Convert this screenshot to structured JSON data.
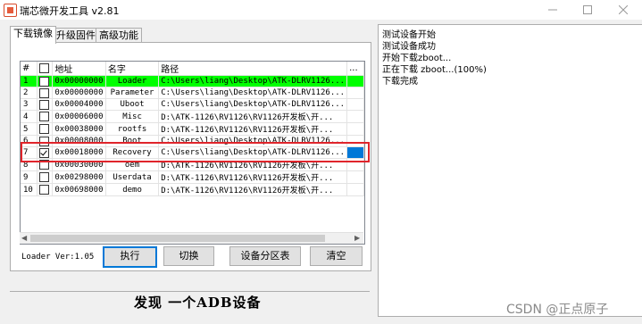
{
  "window": {
    "title": "瑞芯微开发工具 v2.81"
  },
  "tabs": [
    "下载镜像",
    "升级固件",
    "高级功能"
  ],
  "table": {
    "headers": [
      "#",
      "",
      "地址",
      "名字",
      "路径",
      "..."
    ],
    "rows": [
      {
        "num": "1",
        "checked": false,
        "addr": "0x00000000",
        "name": "Loader",
        "path": "C:\\Users\\liang\\Desktop\\ATK-DLRV1126..."
      },
      {
        "num": "2",
        "checked": false,
        "addr": "0x00000000",
        "name": "Parameter",
        "path": "C:\\Users\\liang\\Desktop\\ATK-DLRV1126..."
      },
      {
        "num": "3",
        "checked": false,
        "addr": "0x00004000",
        "name": "Uboot",
        "path": "C:\\Users\\liang\\Desktop\\ATK-DLRV1126..."
      },
      {
        "num": "4",
        "checked": false,
        "addr": "0x00006000",
        "name": "Misc",
        "path": "D:\\ATK-1126\\RV1126\\RV1126开发板\\开..."
      },
      {
        "num": "5",
        "checked": false,
        "addr": "0x00038000",
        "name": "rootfs",
        "path": "D:\\ATK-1126\\RV1126\\RV1126开发板\\开..."
      },
      {
        "num": "6",
        "checked": false,
        "addr": "0x00008000",
        "name": "Boot",
        "path": "C:\\Users\\liang\\Desktop\\ATK-DLRV1126..."
      },
      {
        "num": "7",
        "checked": true,
        "addr": "0x00018000",
        "name": "Recovery",
        "path": "C:\\Users\\liang\\Desktop\\ATK-DLRV1126..."
      },
      {
        "num": "8",
        "checked": false,
        "addr": "0x00030000",
        "name": "oem",
        "path": "D:\\ATK-1126\\RV1126\\RV1126开发板\\开..."
      },
      {
        "num": "9",
        "checked": false,
        "addr": "0x00298000",
        "name": "Userdata",
        "path": "D:\\ATK-1126\\RV1126\\RV1126开发板\\开..."
      },
      {
        "num": "10",
        "checked": false,
        "addr": "0x00698000",
        "name": "demo",
        "path": "D:\\ATK-1126\\RV1126\\RV1126开发板\\开..."
      }
    ]
  },
  "loader_version": "Loader Ver:1.05",
  "buttons": {
    "execute": "执行",
    "switch": "切换",
    "partition": "设备分区表",
    "clear": "清空"
  },
  "status": "发现 一个ADB设备",
  "log_lines": [
    "测试设备开始",
    "测试设备成功",
    "开始下载zboot...",
    "正在下载 zboot...(100%)",
    "下载完成"
  ],
  "watermark": "CSDN @正点原子",
  "colors": {
    "loader_row": "#00ff00",
    "selected_cell": "#0078d7",
    "highlight_box": "#e0242b"
  }
}
